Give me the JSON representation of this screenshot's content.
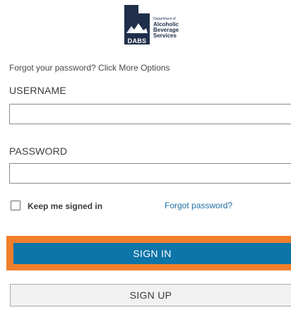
{
  "logo": {
    "acronym": "DABS",
    "line_small": "Department of",
    "line1": "Alcoholic",
    "line2": "Beverage",
    "line3": "Services",
    "brand_color": "#1f2f4a"
  },
  "login": {
    "forgot_hint": "Forgot your password? Click More Options",
    "username_label": "USERNAME",
    "username_value": "",
    "password_label": "PASSWORD",
    "password_value": "",
    "keep_signed_in_label": "Keep me signed in",
    "keep_signed_in_checked": false,
    "forgot_link": "Forgot password?",
    "sign_in_label": "SIGN IN",
    "sign_up_label": "SIGN UP"
  },
  "colors": {
    "primary_button": "#0d75a8",
    "highlight_outline": "#f07f2c",
    "link": "#1f6fa6"
  }
}
